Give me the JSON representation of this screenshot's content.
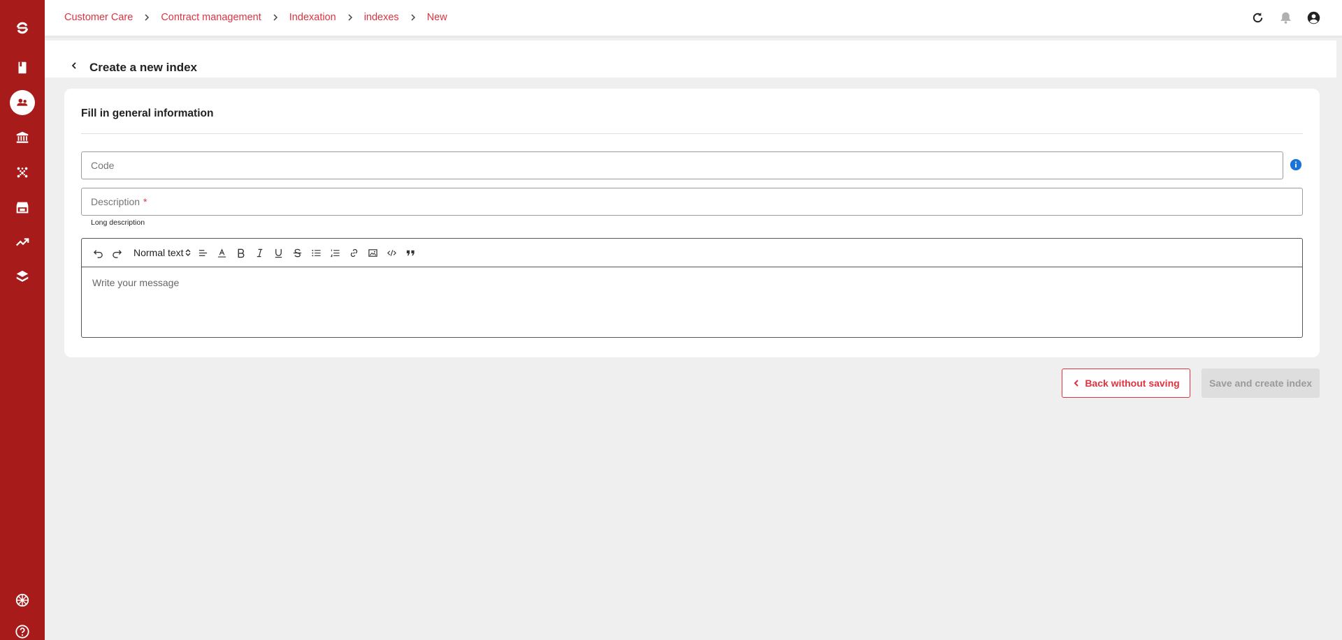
{
  "breadcrumb": {
    "items": [
      "Customer Care",
      "Contract management",
      "Indexation",
      "indexes",
      "New"
    ]
  },
  "page": {
    "title": "Create a new index"
  },
  "form": {
    "section_title": "Fill in general information",
    "code_placeholder": "Code",
    "description_label": "Description",
    "required_mark": "*",
    "long_description_label": "Long description",
    "editor": {
      "text_style": "Normal text",
      "placeholder": "Write your message"
    }
  },
  "actions": {
    "back_label": "Back without saving",
    "save_label": "Save and create index"
  },
  "colors": {
    "sidebar": "#a81b1b",
    "accent": "#e0323f",
    "info": "#1a73d9"
  },
  "icons": {
    "sidebar": [
      "app-logo-icon",
      "book-icon",
      "people-icon",
      "bank-icon",
      "molecule-icon",
      "store-icon",
      "trending-up-icon",
      "layers-icon",
      "language-globe-icon",
      "help-icon"
    ],
    "topbar": [
      "refresh-icon",
      "bell-icon",
      "user-account-icon"
    ]
  }
}
